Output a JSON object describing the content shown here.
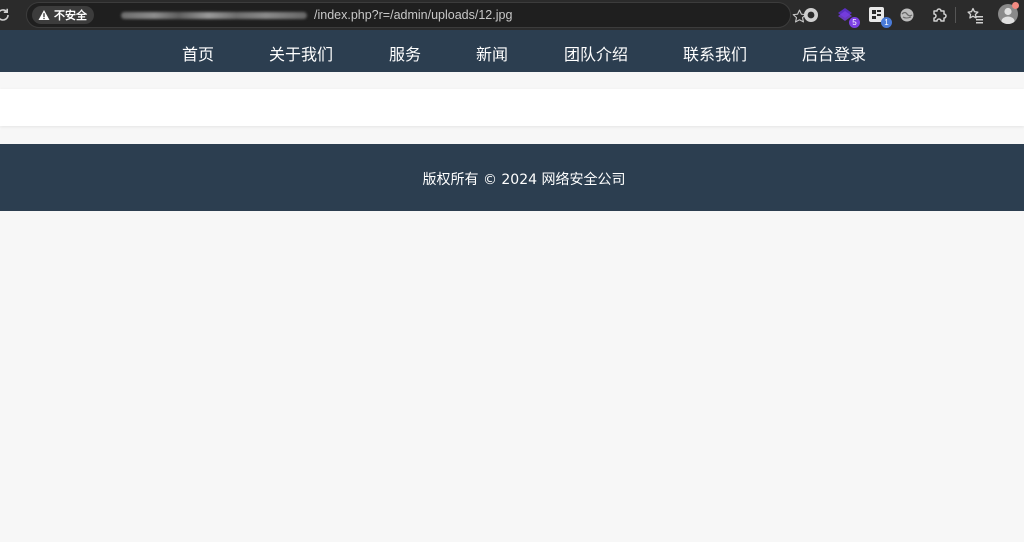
{
  "browser": {
    "security_label": "不安全",
    "url_visible": "/index.php?r=/admin/uploads/12.jpg",
    "extensions": [
      {
        "icon": "record-icon",
        "badge": ""
      },
      {
        "icon": "extension-purple-icon",
        "badge": "5"
      },
      {
        "icon": "extension-translate-icon",
        "badge": "1"
      },
      {
        "icon": "extension-globe-icon",
        "badge": ""
      },
      {
        "icon": "puzzle-icon",
        "badge": ""
      },
      {
        "icon": "reading-list-icon",
        "badge": ""
      }
    ]
  },
  "nav": {
    "items": [
      {
        "label": "首页"
      },
      {
        "label": "关于我们"
      },
      {
        "label": "服务"
      },
      {
        "label": "新闻"
      },
      {
        "label": "团队介绍"
      },
      {
        "label": "联系我们"
      },
      {
        "label": "后台登录"
      }
    ]
  },
  "footer": {
    "copyright": "版权所有 © 2024 网络安全公司"
  },
  "colors": {
    "nav_bg": "#2c3e50",
    "footer_bg": "#2c3e50",
    "page_bg": "#f7f7f7",
    "chrome_bg": "#2b2b2b",
    "badge_purple": "#7b3fe4",
    "badge_blue": "#4a7bd8"
  }
}
